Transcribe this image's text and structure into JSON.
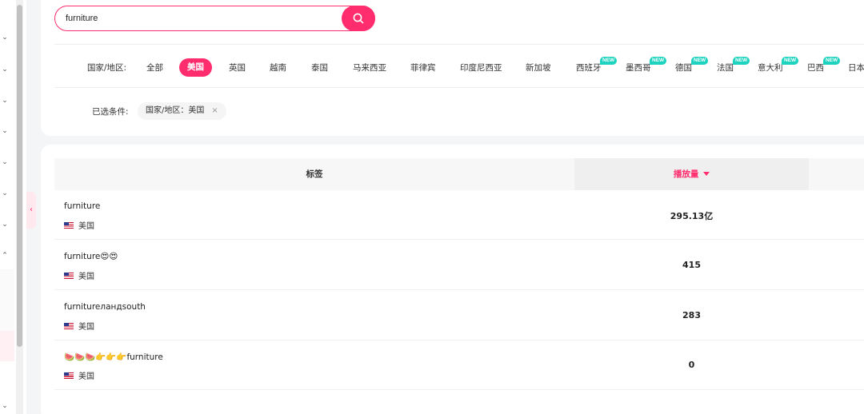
{
  "search": {
    "value": "furniture",
    "placeholder": ""
  },
  "filters": {
    "country_label": "国家/地区:",
    "countries": [
      {
        "label": "全部",
        "active": false,
        "new": false
      },
      {
        "label": "美国",
        "active": true,
        "new": false
      },
      {
        "label": "英国",
        "active": false,
        "new": false
      },
      {
        "label": "越南",
        "active": false,
        "new": false
      },
      {
        "label": "泰国",
        "active": false,
        "new": false
      },
      {
        "label": "马来西亚",
        "active": false,
        "new": false
      },
      {
        "label": "菲律宾",
        "active": false,
        "new": false
      },
      {
        "label": "印度尼西亚",
        "active": false,
        "new": false
      },
      {
        "label": "新加坡",
        "active": false,
        "new": false
      },
      {
        "label": "西班牙",
        "active": false,
        "new": true
      },
      {
        "label": "墨西哥",
        "active": false,
        "new": true
      },
      {
        "label": "德国",
        "active": false,
        "new": true
      },
      {
        "label": "法国",
        "active": false,
        "new": true
      },
      {
        "label": "意大利",
        "active": false,
        "new": true
      },
      {
        "label": "巴西",
        "active": false,
        "new": true
      },
      {
        "label": "日本",
        "active": false,
        "new": false
      }
    ],
    "new_badge": "NEW",
    "selected_label": "已选条件:",
    "selected_chip": "国家/地区：美国",
    "chip_close": "×"
  },
  "table": {
    "col_tag": "标签",
    "col_plays": "播放量",
    "sort_icon": "caret-down-icon",
    "rows": [
      {
        "tag": "furniture",
        "region": "美国",
        "plays": "295.13亿"
      },
      {
        "tag": "furniture😍😍",
        "region": "美国",
        "plays": "415"
      },
      {
        "tag": "furnitureлaндsouth",
        "region": "美国",
        "plays": "283"
      },
      {
        "tag": "🍉🍉🍉👉👉👉furniture",
        "region": "美国",
        "plays": "0"
      }
    ]
  },
  "colors": {
    "accent": "#ff2d6d",
    "new_badge": "#1dd3c0"
  }
}
